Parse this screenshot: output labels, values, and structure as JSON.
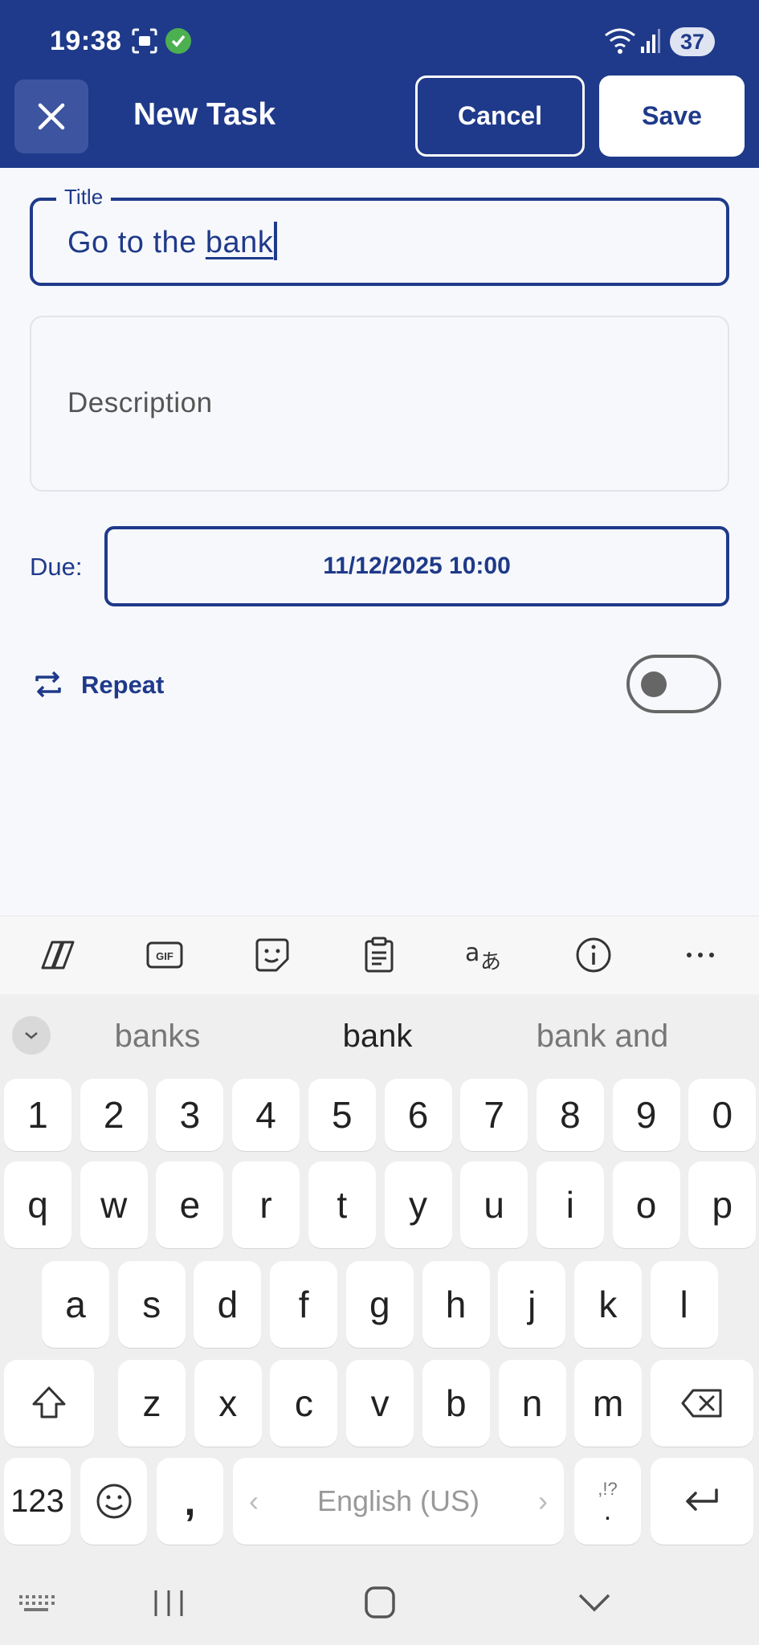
{
  "status_bar": {
    "time": "19:38",
    "battery": "37"
  },
  "app_bar": {
    "title": "New Task",
    "cancel_label": "Cancel",
    "save_label": "Save"
  },
  "form": {
    "title_label": "Title",
    "title_value_prefix": "Go to the ",
    "title_value_word": "bank",
    "description_placeholder": "Description",
    "due_label": "Due:",
    "due_value": "11/12/2025 10:00",
    "repeat_label": "Repeat",
    "repeat_on": false
  },
  "keyboard": {
    "suggestions": [
      "banks",
      "bank",
      "bank and"
    ],
    "row_numbers": [
      "1",
      "2",
      "3",
      "4",
      "5",
      "6",
      "7",
      "8",
      "9",
      "0"
    ],
    "row1": [
      "q",
      "w",
      "e",
      "r",
      "t",
      "y",
      "u",
      "i",
      "o",
      "p"
    ],
    "row2": [
      "a",
      "s",
      "d",
      "f",
      "g",
      "h",
      "j",
      "k",
      "l"
    ],
    "row3": [
      "z",
      "x",
      "c",
      "v",
      "b",
      "n",
      "m"
    ],
    "numbers_key": "123",
    "comma_key": ",",
    "space_label": "English (US)",
    "punct_top": ",!?",
    "punct_bottom": "."
  },
  "colors": {
    "primary": "#1f3a8a",
    "background": "#f7f8fb",
    "keyboard": "#efefef"
  }
}
